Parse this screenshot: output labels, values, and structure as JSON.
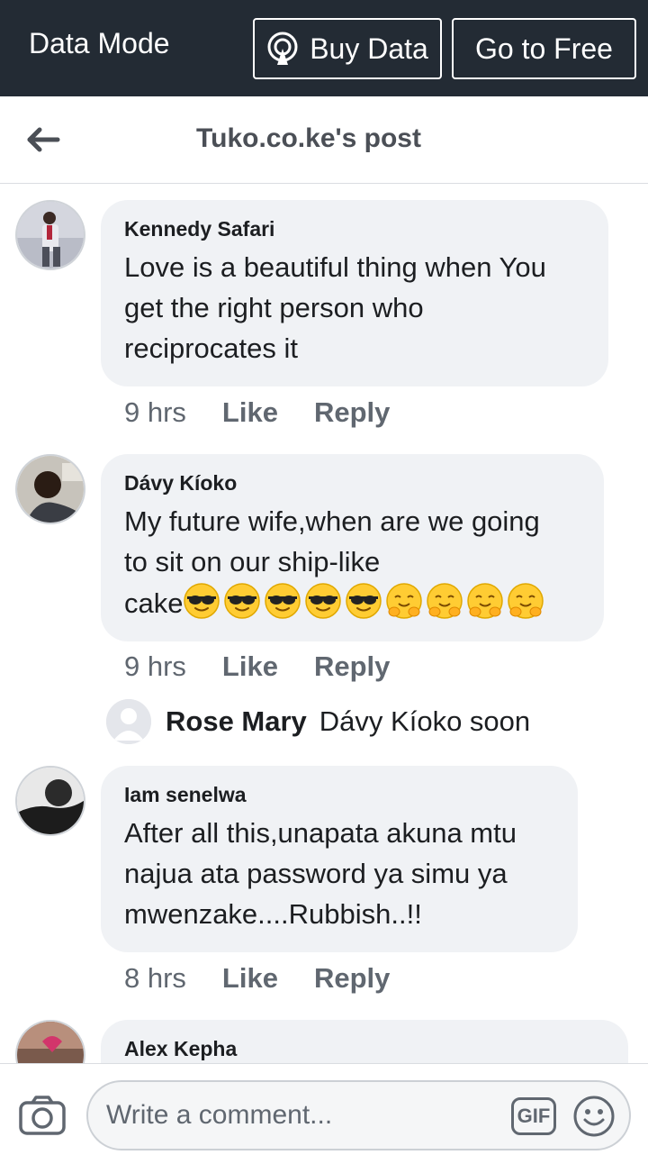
{
  "topbar": {
    "mode_label": "Data Mode",
    "buy_label": "Buy Data",
    "free_label": "Go to Free"
  },
  "header": {
    "title": "Tuko.co.ke's post"
  },
  "comments": [
    {
      "author": "Kennedy Safari",
      "text_lines": [
        "Love is a beautiful thing when You",
        "get the right person who",
        "reciprocates it"
      ],
      "time": "9 hrs",
      "like": "Like",
      "reply": "Reply"
    },
    {
      "author": "Dávy Kíoko",
      "text_lines": [
        "My future wife,when are we going",
        "to sit on our ship-like",
        "cake"
      ],
      "emojis": [
        "sunglasses-emoji",
        "sunglasses-emoji",
        "sunglasses-emoji",
        "sunglasses-emoji",
        "sunglasses-emoji",
        "hugging-emoji",
        "hugging-emoji",
        "hugging-emoji",
        "hugging-emoji"
      ],
      "time": "9 hrs",
      "like": "Like",
      "reply": "Reply",
      "reply_preview": {
        "author": "Rose Mary",
        "text": "Dávy Kíoko soon"
      }
    },
    {
      "author": "Iam senelwa",
      "text_lines": [
        "After all this,unapata akuna mtu",
        "najua ata password ya simu ya",
        "mwenzake....Rubbish..!!"
      ],
      "time": "8 hrs",
      "like": "Like",
      "reply": "Reply"
    },
    {
      "author": "Alex Kepha"
    }
  ],
  "composer": {
    "placeholder": "Write a comment...",
    "gif_label": "GIF"
  },
  "colors": {
    "topbar_bg": "#232b34",
    "bubble_bg": "#f0f2f5",
    "meta_text": "#606770"
  }
}
